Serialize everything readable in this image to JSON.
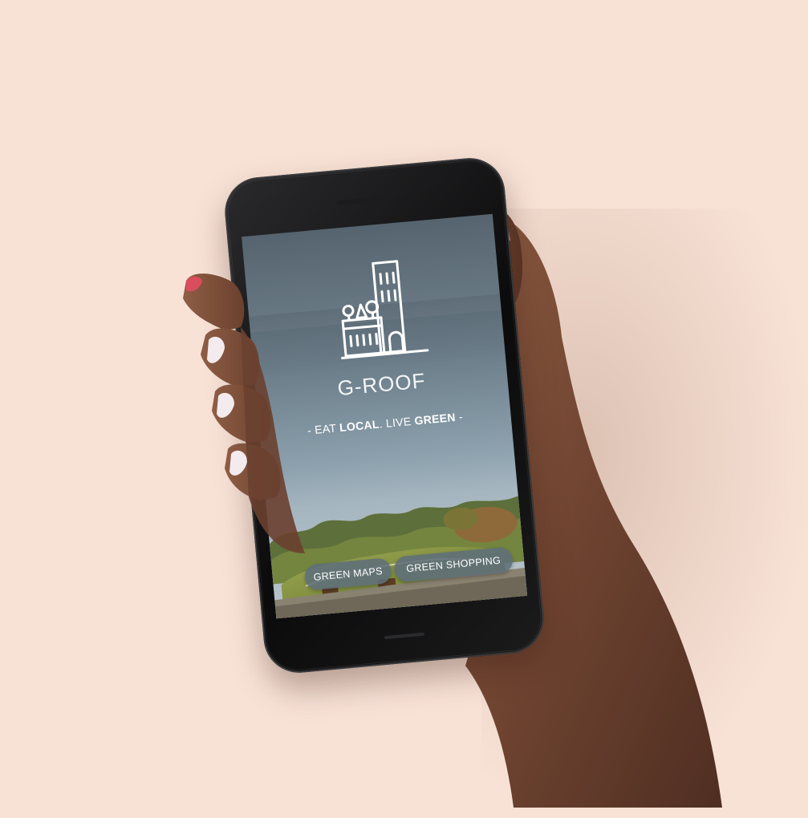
{
  "app": {
    "title": "G-ROOF",
    "tagline": {
      "prefix": "- EAT ",
      "local": "LOCAL",
      "middle": ". LIVE ",
      "green": "GREEN",
      "suffix": " -"
    }
  },
  "buttons": {
    "green_maps": "GREEN MAPS",
    "green_shopping": "GREEN SHOPPING"
  },
  "icons": {
    "logo": "building-with-rooftop-trees-icon"
  },
  "colors": {
    "background": "#f8e2d6",
    "screen_top": "#56646f",
    "button": "#5f6e7a",
    "text": "#ffffff"
  }
}
